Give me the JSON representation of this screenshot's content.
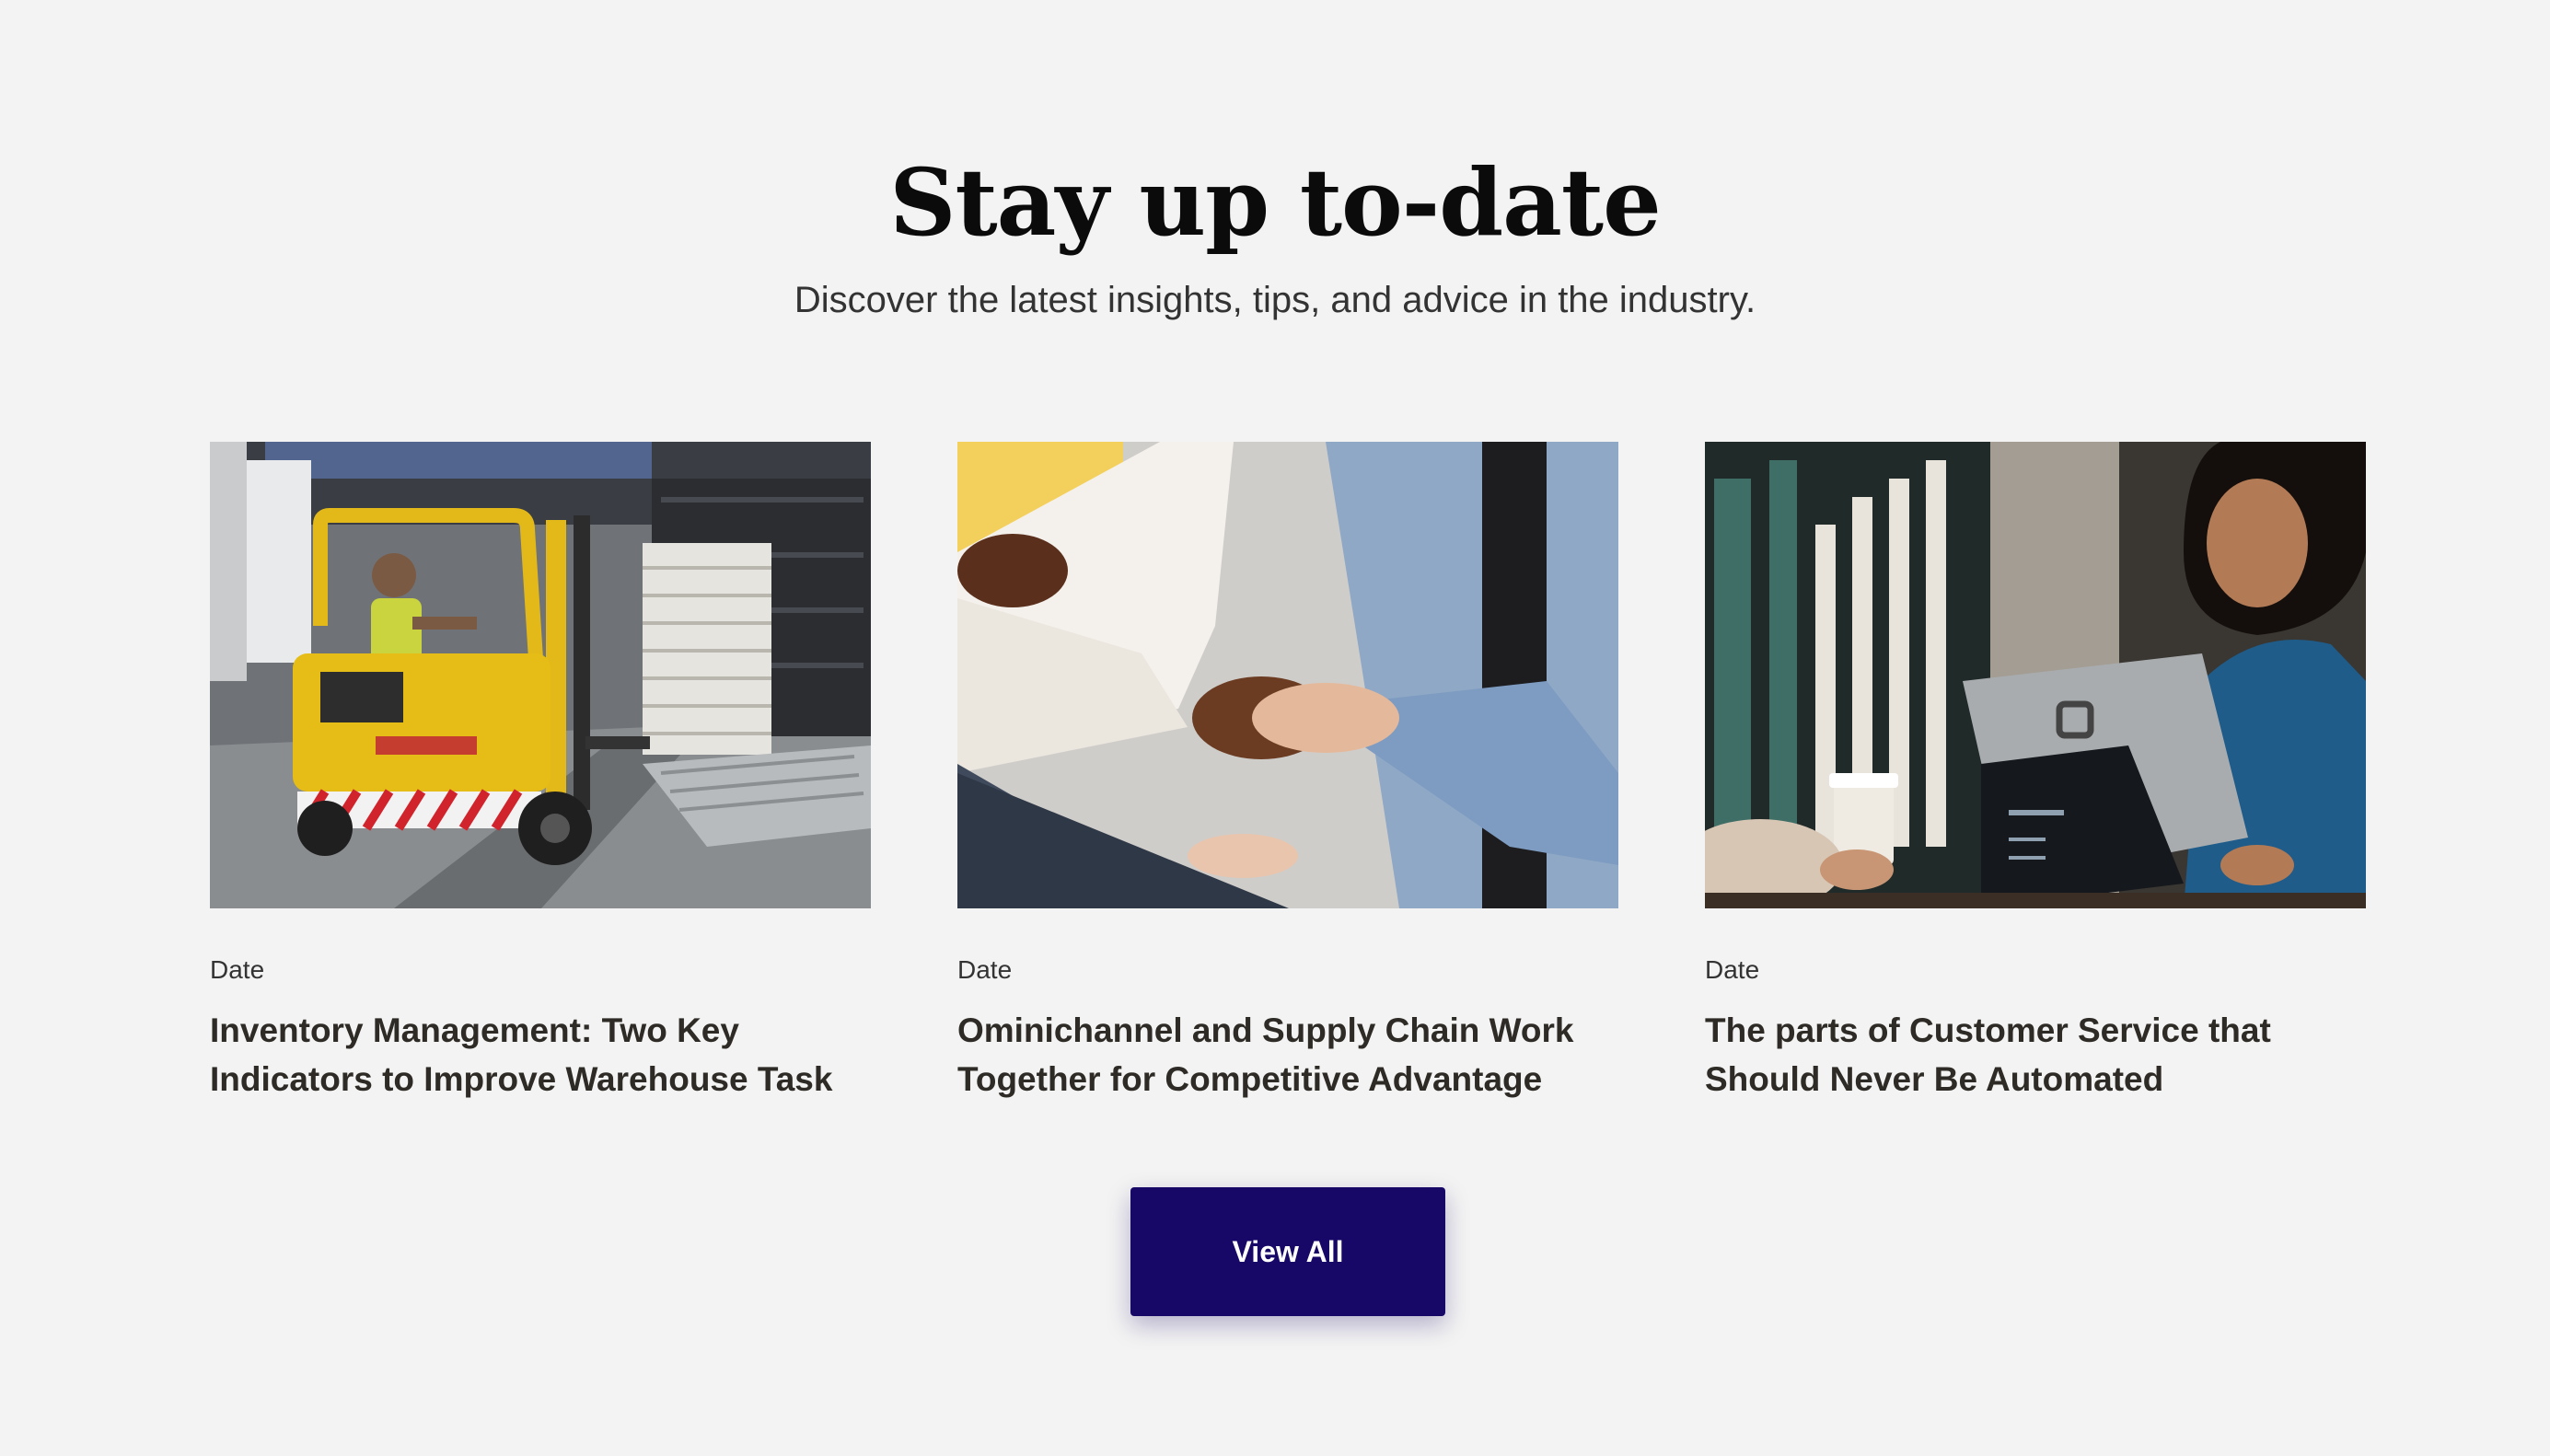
{
  "section": {
    "heading": "Stay up to-date",
    "subheading": "Discover the latest insights, tips, and advice in the industry."
  },
  "posts": [
    {
      "image_icon": "forklift-warehouse-photo",
      "date": "Date",
      "title": "Inventory Management: Two Key Indicators to Improve Warehouse Task"
    },
    {
      "image_icon": "handshake-photo",
      "date": "Date",
      "title": "Ominichannel and Supply Chain Work Together for Competitive Advantage"
    },
    {
      "image_icon": "pos-checkout-photo",
      "date": "Date",
      "title": "The parts of Customer Service that Should Never Be Automated"
    }
  ],
  "view_all": {
    "label": "View All"
  },
  "colors": {
    "background": "#f3f3f3",
    "button": "#170766",
    "heading": "#0b0b0b",
    "title": "#2e2b26"
  }
}
